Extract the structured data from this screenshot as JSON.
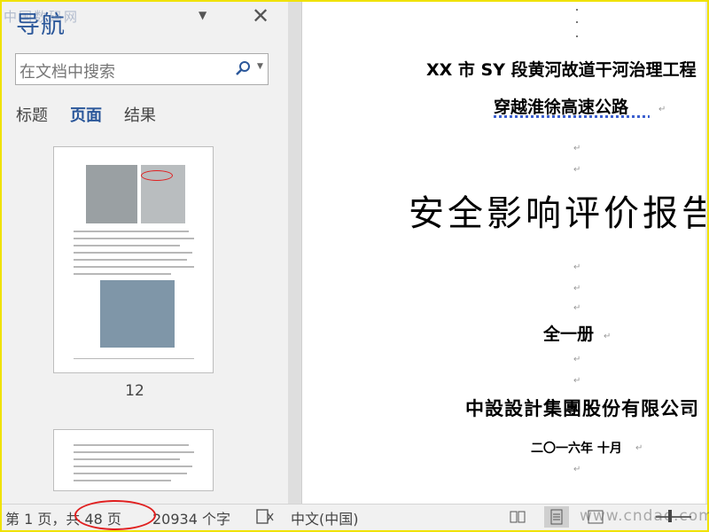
{
  "nav": {
    "title": "导航",
    "watermark": "中国数码网",
    "search_placeholder": "在文档中搜索",
    "tabs": [
      {
        "label": "标题",
        "active": false
      },
      {
        "label": "页面",
        "active": true
      },
      {
        "label": "结果",
        "active": false
      }
    ],
    "page_label": "12"
  },
  "document": {
    "line1": "XX 市 SY 段黄河故道干河治理工程",
    "line2": "穿越淮徐高速公路",
    "line3": "安全影响评价报告",
    "line4": "全一册",
    "line5": "中設設計集團股份有限公司",
    "line6": "二〇一六年  十月",
    "para_mark": "↵"
  },
  "status": {
    "page": "第 1 页，共 48 页",
    "words": "20934 个字",
    "language": "中文(中国)",
    "watermark": "www.cndao.com"
  },
  "colors": {
    "accent": "#2b579a",
    "highlight_border": "#f0e200",
    "annotation": "#e02020"
  }
}
